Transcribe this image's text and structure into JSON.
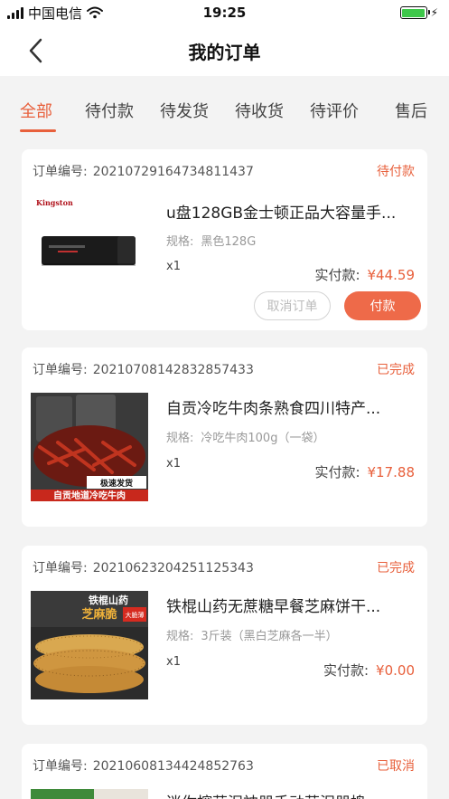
{
  "status_bar": {
    "carrier": "中国电信",
    "time": "19:25",
    "battery_level": 1.0
  },
  "nav": {
    "title": "我的订单"
  },
  "tabs": [
    {
      "label": "全部",
      "active": true
    },
    {
      "label": "待付款",
      "active": false
    },
    {
      "label": "待发货",
      "active": false
    },
    {
      "label": "待收货",
      "active": false
    },
    {
      "label": "待评价",
      "active": false
    },
    {
      "label": "售后",
      "active": false
    }
  ],
  "labels": {
    "order_no": "订单编号:",
    "spec": "规格:",
    "paid": "实付款:"
  },
  "orders": [
    {
      "number": "2021072916473481143​7",
      "status": "待付款",
      "title": "u盘128GB金士顿正品大容量手...",
      "spec": "黑色128G",
      "qty": "x1",
      "amount": "¥44.59",
      "image_brand": "Kingston",
      "buttons": {
        "cancel": "取消订单",
        "pay": "付款"
      }
    },
    {
      "number": "2021070814283285743​3",
      "status": "已完成",
      "title": "自贡冷吃牛肉条熟食四川特产...",
      "spec": "冷吃牛肉100g（一袋）",
      "qty": "x1",
      "amount": "¥17.88",
      "image_badge": "极速发货",
      "image_caption": "自贡地道冷吃牛肉"
    },
    {
      "number": "20210623204251125343",
      "status": "已完成",
      "title": "铁棍山药无蔗糖早餐芝麻饼干...",
      "spec": "3斤装（黑白芝麻各一半）",
      "qty": "x1",
      "amount": "¥0.00",
      "image_caption_top": "铁棍山药",
      "image_caption_sub": "芝麻脆",
      "image_badge": "大脆薄"
    },
    {
      "number": "20210608134424852763",
      "status": "已取消",
      "title": "迷你榨蒜泥神器手动蒜泥器捣"
    }
  ],
  "colors": {
    "accent": "#e8603c",
    "pay_button": "#ee6a49",
    "background": "#f3f3f3"
  }
}
